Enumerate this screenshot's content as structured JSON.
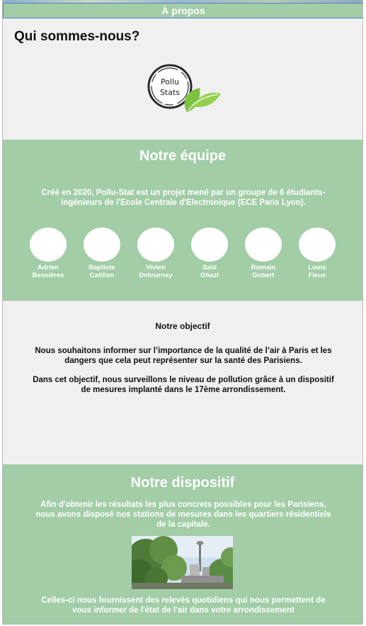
{
  "header": {
    "apropos_label": "À propos"
  },
  "intro": {
    "title": "Qui sommes-nous?",
    "logo_text_line1": "Pollu",
    "logo_text_line2": "Stats"
  },
  "team": {
    "title": "Notre équipe",
    "description": "Créé en 2020, Pollu-Stat est un projet mené par un groupe de 6 étudiants-ingénieurs de l'Ecole Centrale d'Electronique (ECE Paris Lyon).",
    "members": [
      {
        "first": "Adrien",
        "last": "Bessières"
      },
      {
        "first": "Baptiste",
        "last": "Catillon"
      },
      {
        "first": "Vivien",
        "last": "Detournay"
      },
      {
        "first": "Saïd",
        "last": "Ghazi"
      },
      {
        "first": "Romain",
        "last": "Gobert"
      },
      {
        "first": "Louis",
        "last": "Fieux"
      }
    ]
  },
  "objective": {
    "title": "Notre objectif",
    "paragraph1": "Nous souhaitons informer sur l’importance de la qualité de l’air à Paris et les dangers que cela peut représenter sur la santé des Parisiens.",
    "paragraph2": "Dans cet objectif, nous surveillons le niveau de pollution grâce à un dispositif de mesures implanté dans le 17ème arrondissement."
  },
  "device": {
    "title": "Notre dispositif",
    "paragraph1": "Afin d'obtenir les résultats les plus concrets possibles pour les Parisiens, nous avons disposé nos stations de mesures dans les quartiers résidentiels de la capitale.",
    "paragraph2": "Celles-ci nous fournissent des relevés quotidiens qui nous permettent de vous informer de l'état de l'air dans votre arrondissement"
  },
  "colors": {
    "accent_green": "#a2cda6",
    "leaf_green": "#7cc13f",
    "background": "#f0f0f0"
  }
}
